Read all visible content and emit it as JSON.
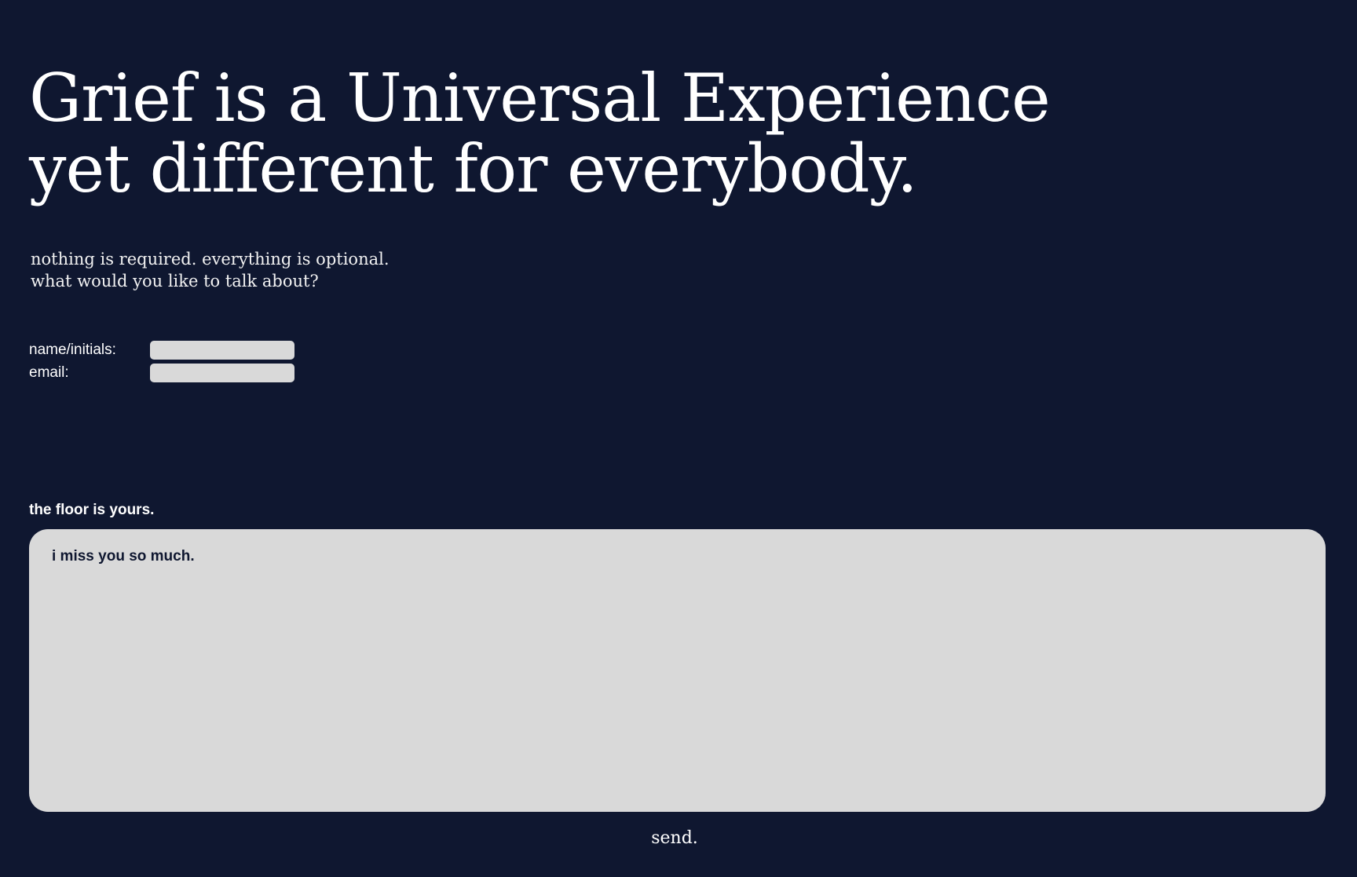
{
  "headline": {
    "line1": "Grief is a Universal Experience",
    "line2": "yet different for everybody."
  },
  "subtitle": {
    "line1": "nothing is required. everything is optional.",
    "line2": "what would you like to talk about?"
  },
  "form": {
    "name_label": "name/initials:",
    "name_value": "",
    "email_label": "email:",
    "email_value": "",
    "floor_label": "the floor is yours.",
    "message_value": "i miss you so much.",
    "send_label": "send."
  },
  "colors": {
    "background": "#0f1730",
    "input_background": "#d9d9d9",
    "text": "#ffffff"
  }
}
